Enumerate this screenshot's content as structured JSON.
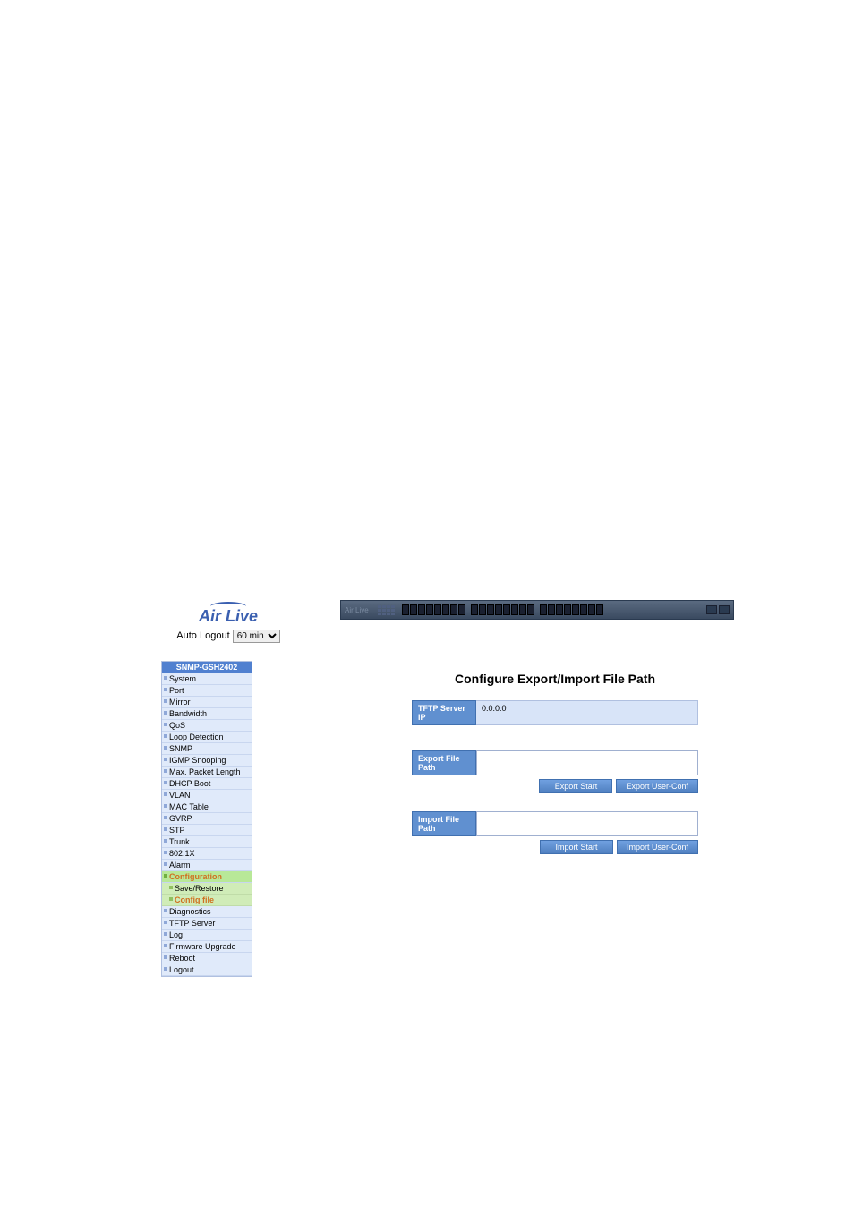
{
  "brand": "Air Live",
  "auto_logout_label": "Auto Logout",
  "auto_logout_value": "60 min",
  "switch_model": "Air Live",
  "nav": {
    "header": "SNMP-GSH2402",
    "items": [
      {
        "label": "System"
      },
      {
        "label": "Port"
      },
      {
        "label": "Mirror"
      },
      {
        "label": "Bandwidth"
      },
      {
        "label": "QoS"
      },
      {
        "label": "Loop Detection"
      },
      {
        "label": "SNMP"
      },
      {
        "label": "IGMP Snooping"
      },
      {
        "label": "Max. Packet Length"
      },
      {
        "label": "DHCP Boot"
      },
      {
        "label": "VLAN"
      },
      {
        "label": "MAC Table"
      },
      {
        "label": "GVRP"
      },
      {
        "label": "STP"
      },
      {
        "label": "Trunk"
      },
      {
        "label": "802.1X"
      },
      {
        "label": "Alarm"
      },
      {
        "label": "Configuration",
        "expanded": true,
        "children": [
          {
            "label": "Save/Restore"
          },
          {
            "label": "Config file",
            "active": true
          }
        ]
      },
      {
        "label": "Diagnostics"
      },
      {
        "label": "TFTP Server"
      },
      {
        "label": "Log"
      },
      {
        "label": "Firmware Upgrade"
      },
      {
        "label": "Reboot"
      },
      {
        "label": "Logout"
      }
    ]
  },
  "main": {
    "title": "Configure Export/Import File Path",
    "tftp_label": "TFTP Server IP",
    "tftp_value": "0.0.0.0",
    "export_label": "Export File Path",
    "export_value": "",
    "export_start_btn": "Export Start",
    "export_user_btn": "Export User-Conf",
    "import_label": "Import File Path",
    "import_value": "",
    "import_start_btn": "Import Start",
    "import_user_btn": "Import User-Conf"
  }
}
